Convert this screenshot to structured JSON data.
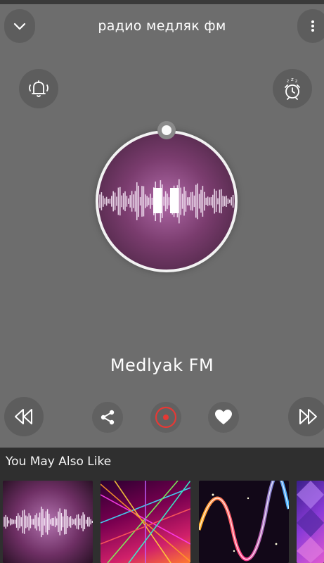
{
  "header": {
    "title": "радио медляк фм",
    "collapse_icon": "chevron-down-icon",
    "menu_icon": "more-vertical-icon"
  },
  "actions": {
    "notify_icon": "bell-icon",
    "sleep_timer_icon": "alarm-clock-icon"
  },
  "player": {
    "station_name": "Medlyak FM",
    "state": "playing",
    "play_pause_icon": "pause-icon"
  },
  "controls": {
    "rewind_icon": "rewind-icon",
    "share_icon": "share-icon",
    "record_icon": "record-icon",
    "favorite_icon": "heart-icon",
    "forward_icon": "fast-forward-icon"
  },
  "recommendations": {
    "title": "You May Also Like",
    "items": [
      {
        "artwork": "pink-waveform"
      },
      {
        "artwork": "laser-lights"
      },
      {
        "artwork": "neon-wave"
      },
      {
        "artwork": "purple-geometric"
      }
    ]
  },
  "colors": {
    "background": "#6d6d6d",
    "panel": "#2f2f2f",
    "record_accent": "#e53935",
    "disc_purple": "#7a3c6e"
  }
}
